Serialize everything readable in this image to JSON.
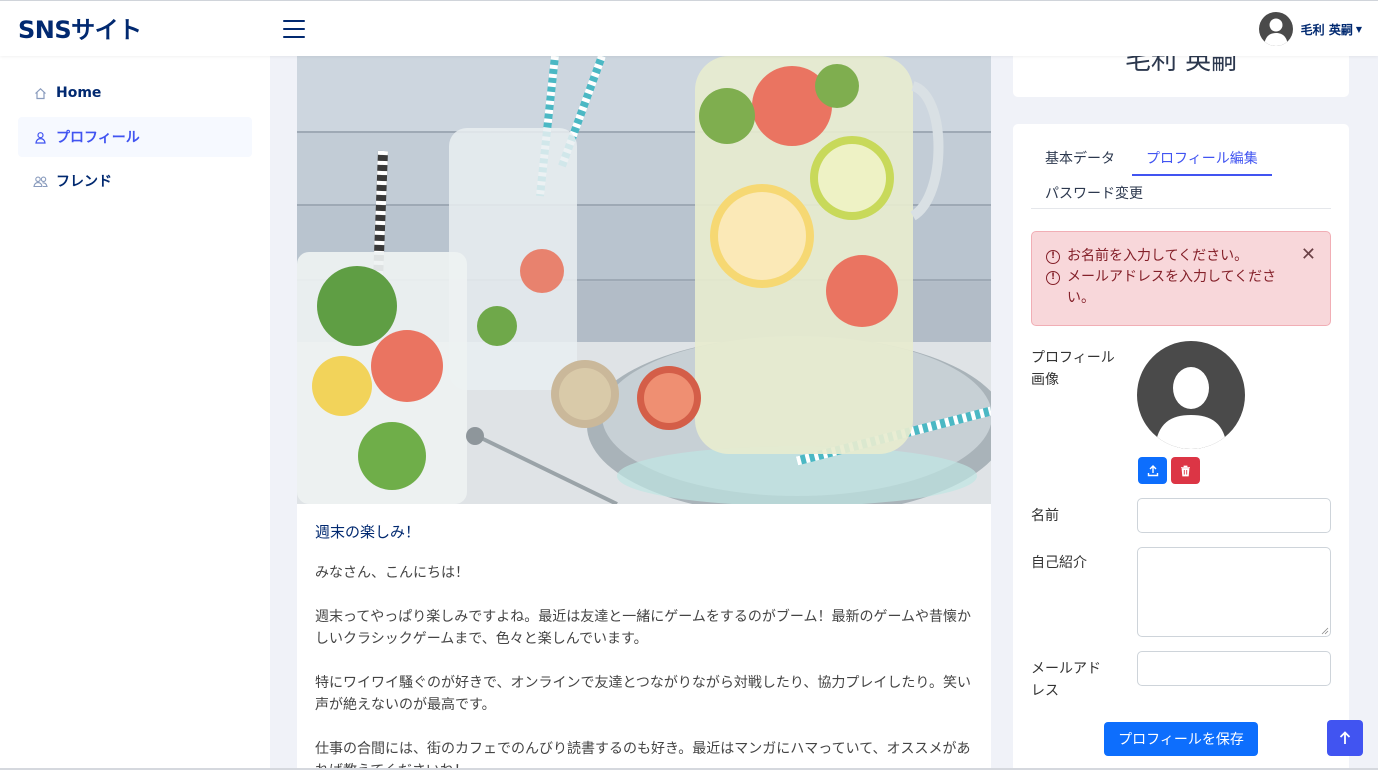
{
  "header": {
    "brand": "SNSサイト",
    "user_name": "毛利 英嗣"
  },
  "sidebar": {
    "items": [
      {
        "label": "Home",
        "icon": "house-icon"
      },
      {
        "label": "プロフィール",
        "icon": "person-icon",
        "active": true
      },
      {
        "label": "フレンド",
        "icon": "people-icon"
      }
    ]
  },
  "post": {
    "title": "週末の楽しみ！",
    "body": "みなさん、こんにちは！\n\n週末ってやっぱり楽しみですよね。最近は友達と一緒にゲームをするのがブーム！最新のゲームや昔懐かしいクラシックゲームまで、色々と楽しんでいます。\n\n特にワイワイ騒ぐのが好きで、オンラインで友達とつながりながら対戦したり、協力プレイしたり。笑い声が絶えないのが最高です。\n\n仕事の合間には、街のカフェでのんびり読書するのも好き。最近はマンガにハマっていて、オススメがあれば教えてくださいね！"
  },
  "profile_card": {
    "name": "毛利 英嗣"
  },
  "tabs": [
    {
      "label": "基本データ"
    },
    {
      "label": "プロフィール編集",
      "active": true
    },
    {
      "label": "パスワード変更"
    }
  ],
  "alert": {
    "messages": [
      "お名前を入力してください。",
      "メールアドレスを入力してください。"
    ]
  },
  "form": {
    "image_label": "プロフィール画像",
    "name_label": "名前",
    "name_value": "",
    "bio_label": "自己紹介",
    "bio_value": "",
    "email_label": "メールアドレス",
    "email_value": "",
    "save_label": "プロフィールを保存"
  },
  "colors": {
    "brand": "#012970",
    "accent": "#4154f1",
    "primary": "#0d6efd",
    "danger": "#dc3545",
    "alert_bg": "#f8d7da"
  }
}
